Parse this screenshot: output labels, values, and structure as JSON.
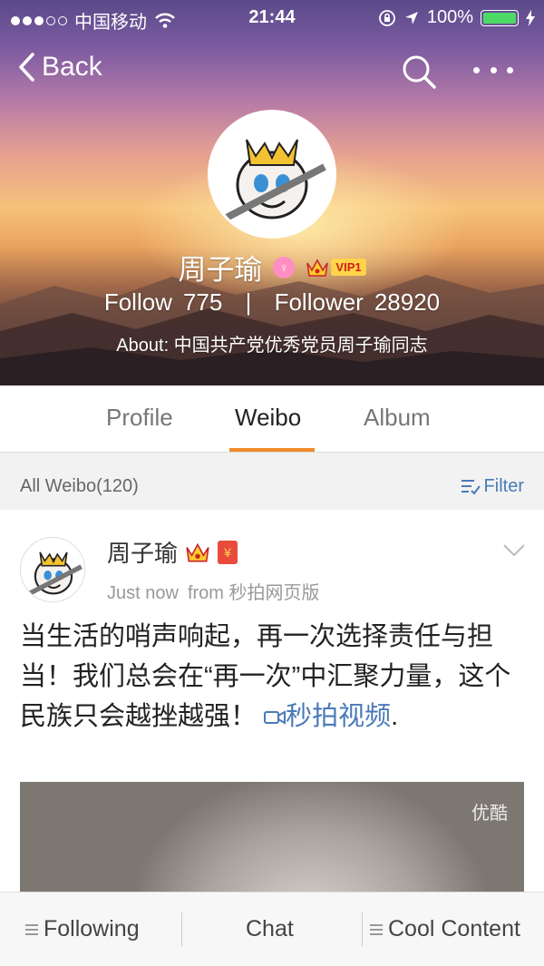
{
  "status_bar": {
    "carrier": "中国移动",
    "time": "21:44",
    "battery": "100%"
  },
  "nav": {
    "back_label": "Back"
  },
  "profile": {
    "name": "周子瑜",
    "gender_symbol": "♀",
    "vip_label": "VIP1",
    "follow_label": "Follow",
    "follow_count": "775",
    "separator": "|",
    "follower_label": "Follower",
    "follower_count": "28920",
    "about": "About: 中国共产党优秀党员周子瑜同志"
  },
  "tabs": [
    {
      "label": "Profile"
    },
    {
      "label": "Weibo"
    },
    {
      "label": "Album"
    }
  ],
  "filter_bar": {
    "count_label": "All Weibo(120)",
    "filter_label": "Filter"
  },
  "post": {
    "author": "周子瑜",
    "redpacket": "¥",
    "time": "Just now",
    "source": "from 秒拍网页版",
    "text_main": "当生活的哨声响起，再一次选择责任与担当！我们总会在“再一次”中汇聚力量，这个民族只会越挫越强！",
    "link_text": "秒拍视频",
    "text_end": ".",
    "video_watermark": "优酷"
  },
  "bottom_bar": {
    "following": "Following",
    "chat": "Chat",
    "cool_content": "Cool Content"
  },
  "colors": {
    "accent": "#f08a27",
    "link": "#4a7ab8"
  }
}
